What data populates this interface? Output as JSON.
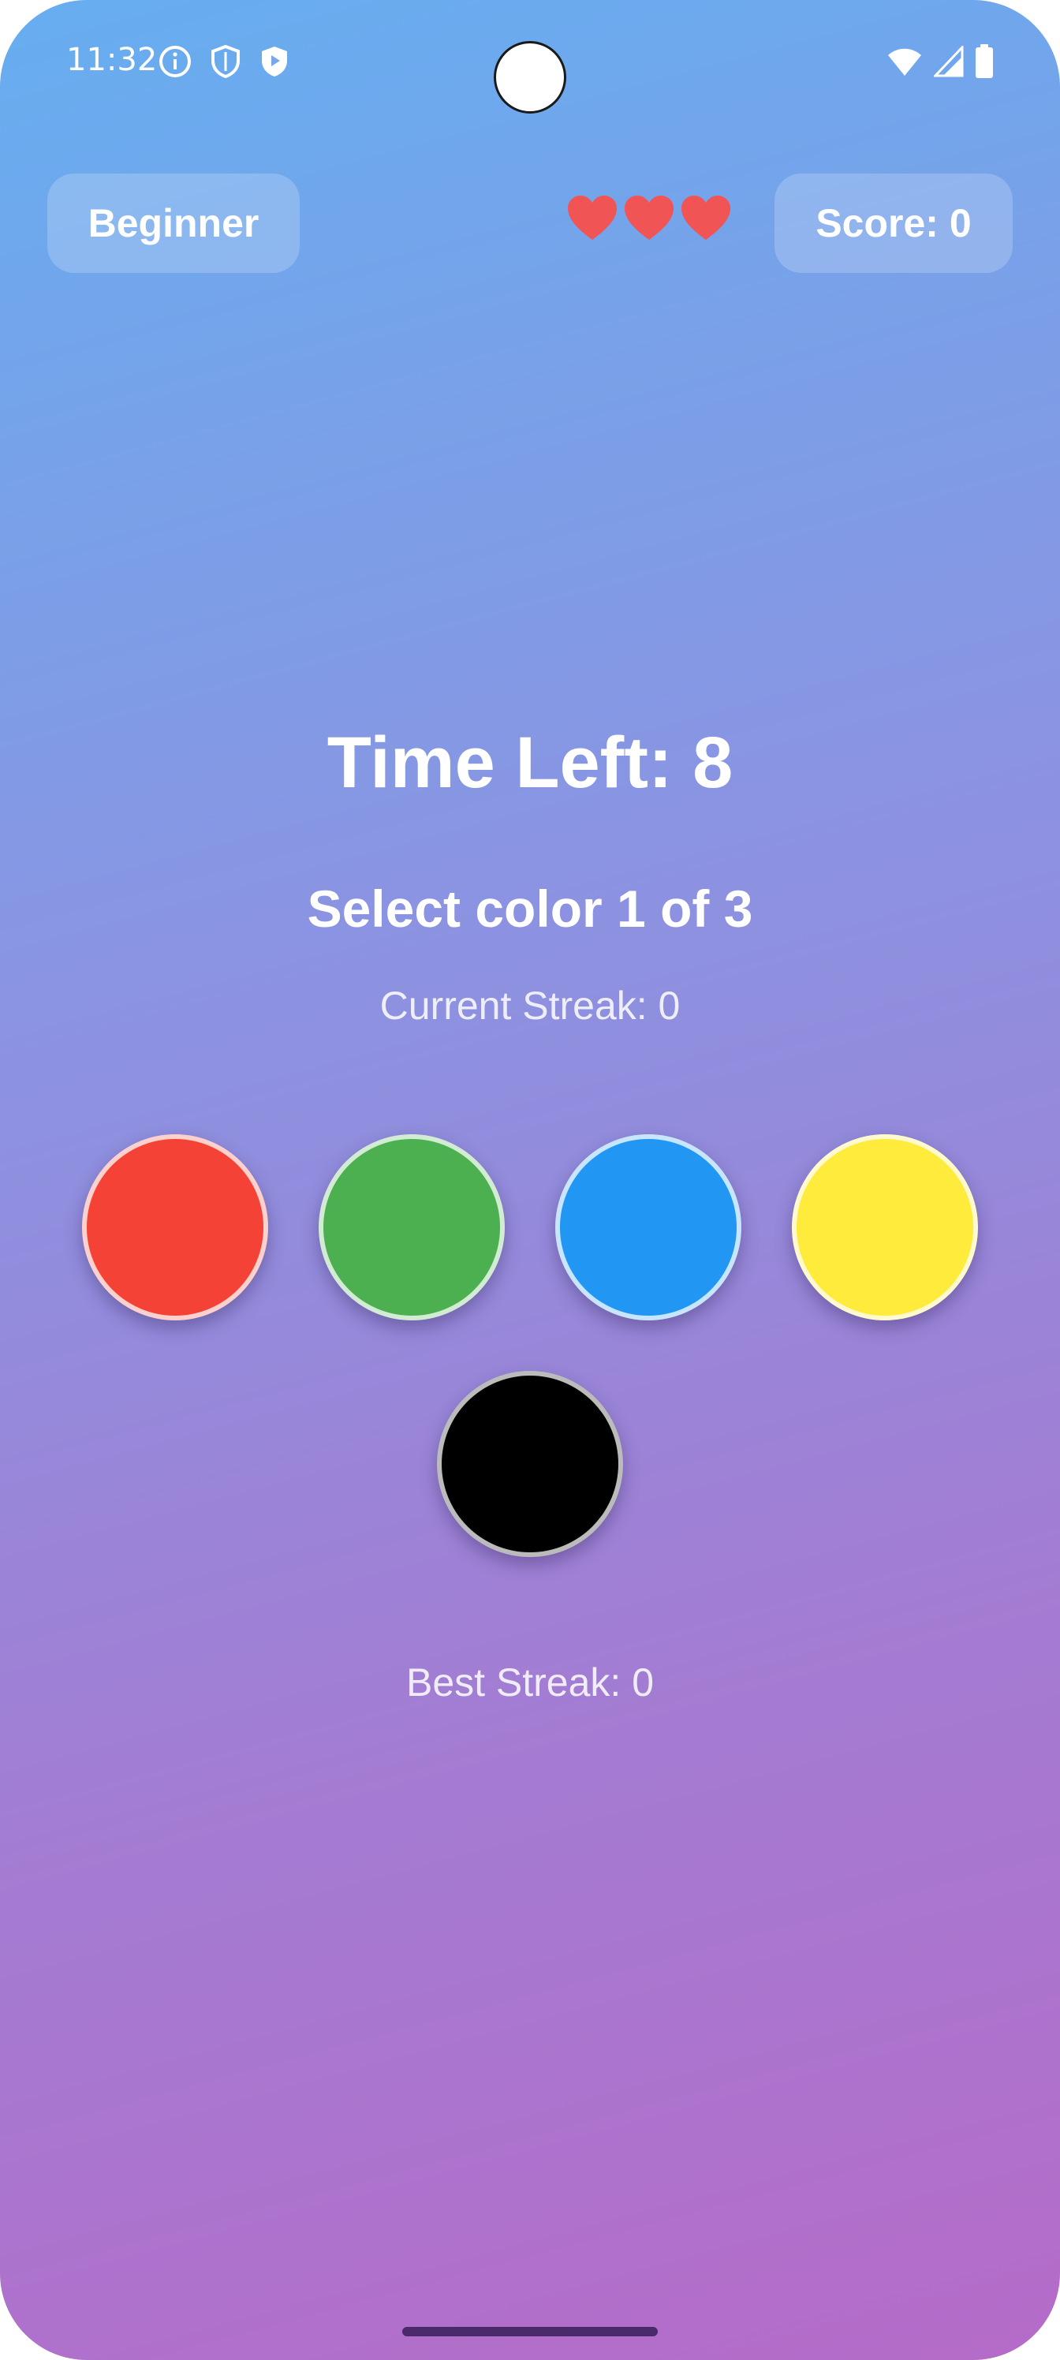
{
  "status_bar": {
    "time": "11:32",
    "left_icons": [
      "info-icon",
      "shield-icon",
      "play-shield-icon"
    ],
    "right_icons": [
      "wifi-icon",
      "signal-icon",
      "battery-icon"
    ]
  },
  "header": {
    "level_label": "Beginner",
    "lives": 3,
    "heart_color": "#f05454",
    "score_label": "Score: 0"
  },
  "game": {
    "time_left": "Time Left: 8",
    "prompt": "Select color 1 of 3",
    "current_streak": "Current Streak: 0",
    "best_streak": "Best Streak: 0",
    "colors": [
      {
        "name": "red",
        "hex": "#f44336"
      },
      {
        "name": "green",
        "hex": "#4caf50"
      },
      {
        "name": "blue",
        "hex": "#2196f3"
      },
      {
        "name": "yellow",
        "hex": "#ffeb3b"
      },
      {
        "name": "black",
        "hex": "#000000"
      }
    ]
  },
  "theme": {
    "gradient_top": "#66aef0",
    "gradient_bottom": "#b56bc8"
  }
}
